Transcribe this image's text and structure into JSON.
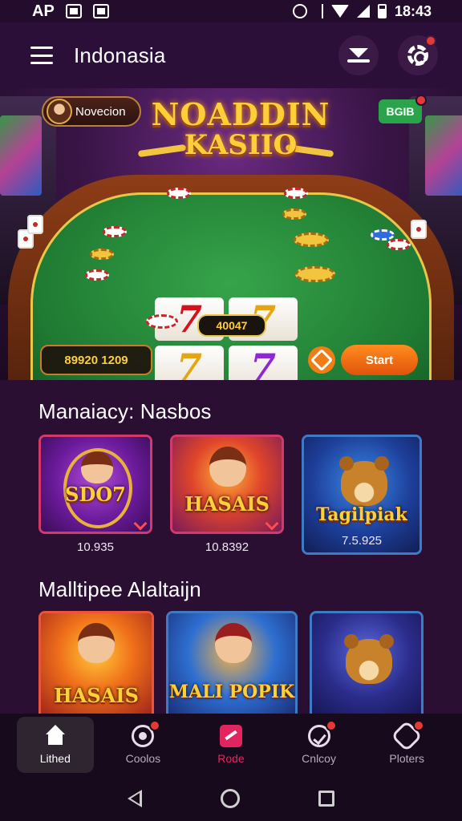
{
  "status_bar": {
    "carrier": "AP",
    "time": "18:43"
  },
  "app_bar": {
    "title": "Indonasia"
  },
  "banner": {
    "logo_line1": "NOADDIN",
    "logo_line2": "KASIIO",
    "user_name": "Novecion",
    "badge_text": "BGIB",
    "pot_value": "40047",
    "balance": "89920 1209",
    "start_label": "Start"
  },
  "section1": {
    "title": "Manaiacy: Nasbos",
    "cards": [
      {
        "art_title": "SDO7",
        "value": "10.935"
      },
      {
        "art_title": "HASAIS",
        "value": "10.8392"
      },
      {
        "art_title": "Tagilpiak",
        "value": "7.5.925"
      }
    ]
  },
  "section2": {
    "title": "Malltipee Alaltaijn",
    "cards": [
      {
        "art_title": "HASAIS"
      },
      {
        "art_title": "MALI POPIK"
      },
      {
        "art_title": ""
      }
    ]
  },
  "bottom_nav": [
    {
      "label": "Lithed",
      "icon": "home-icon"
    },
    {
      "label": "Coolos",
      "icon": "coin-icon"
    },
    {
      "label": "Rode",
      "icon": "ticket-icon"
    },
    {
      "label": "Cnlcoy",
      "icon": "check-circle-icon"
    },
    {
      "label": "Ploters",
      "icon": "badge-icon"
    }
  ],
  "colors": {
    "accent": "#e2245f",
    "gold": "#ffcf3a",
    "background": "#2a0f33"
  }
}
